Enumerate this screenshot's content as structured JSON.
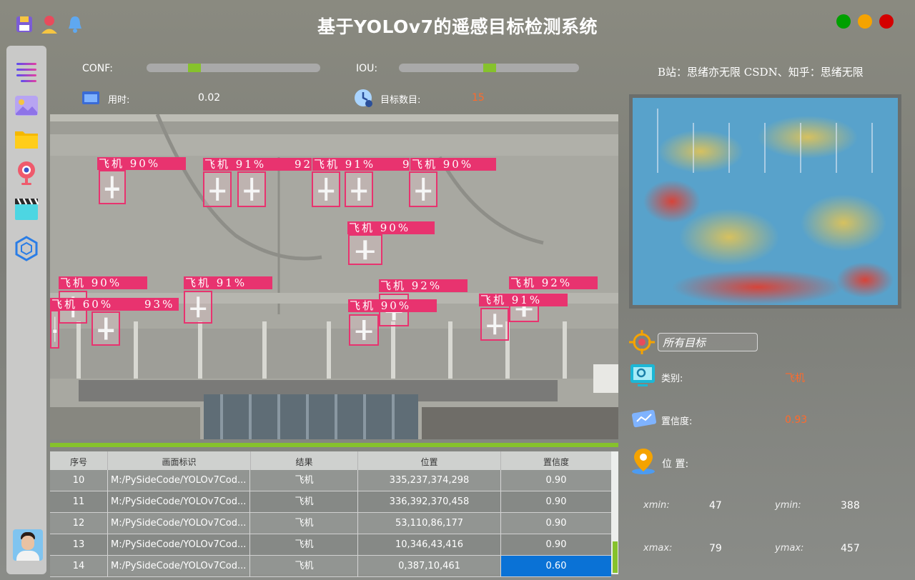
{
  "window": {
    "title": "基于YOLOv7的遥感目标检测系统",
    "title_icons": [
      "save-icon",
      "user-icon",
      "bell-icon"
    ],
    "controls": [
      {
        "name": "close",
        "color": "#00a000"
      },
      {
        "name": "minimize",
        "color": "#f5a300"
      },
      {
        "name": "maximize",
        "color": "#d40000"
      }
    ]
  },
  "sidebar": {
    "items": [
      "menu-icon",
      "image-icon",
      "folder-icon",
      "camera-icon",
      "video-icon",
      "hexagon-icon"
    ],
    "avatar": "avatar"
  },
  "controls": {
    "conf_label": "CONF:",
    "conf_value": 0.3,
    "iou_label": "IOU:",
    "iou_value": 0.5,
    "time_label": "用时:",
    "time_value": "0.02",
    "count_label": "目标数目:",
    "count_value": "15"
  },
  "detection": {
    "boxes": [
      {
        "label": "飞机 90%"
      },
      {
        "label": "飞机 91%"
      },
      {
        "label": "92"
      },
      {
        "label": "飞机 91%"
      },
      {
        "label": "9"
      },
      {
        "label": "飞机 90%"
      },
      {
        "label": "飞机 90%"
      },
      {
        "label": "飞机 90%"
      },
      {
        "label": "飞机 91%"
      },
      {
        "label": "飞机 92%"
      },
      {
        "label": "飞机 92%"
      },
      {
        "label": "飞机 60%"
      },
      {
        "label": "93%"
      },
      {
        "label": "飞机 90%"
      },
      {
        "label": "飞机 91%"
      }
    ]
  },
  "table": {
    "headers": [
      "序号",
      "画面标识",
      "结果",
      "位置",
      "置信度"
    ],
    "rows": [
      {
        "id": "10",
        "source": "M:/PySideCode/YOLOv7Cod...",
        "result": "飞机",
        "pos": "335,237,374,298",
        "conf": "0.90"
      },
      {
        "id": "11",
        "source": "M:/PySideCode/YOLOv7Cod...",
        "result": "飞机",
        "pos": "336,392,370,458",
        "conf": "0.90"
      },
      {
        "id": "12",
        "source": "M:/PySideCode/YOLOv7Cod...",
        "result": "飞机",
        "pos": "53,110,86,177",
        "conf": "0.90"
      },
      {
        "id": "13",
        "source": "M:/PySideCode/YOLOv7Cod...",
        "result": "飞机",
        "pos": "10,346,43,416",
        "conf": "0.90"
      },
      {
        "id": "14",
        "source": "M:/PySideCode/YOLOv7Cod...",
        "result": "飞机",
        "pos": "0,387,10,461",
        "conf": "0.60"
      }
    ],
    "selected_row": 4
  },
  "right": {
    "credit": "B站：思绪亦无限  CSDN、知乎：思绪无限",
    "filter_value": "所有目标",
    "class_label": "类别:",
    "class_value": "飞机",
    "conf_label": "置信度:",
    "conf_value": "0.93",
    "pos_label": "位 置:",
    "xmin_label": "xmin:",
    "xmin_value": "47",
    "ymin_label": "ymin:",
    "ymin_value": "388",
    "xmax_label": "xmax:",
    "xmax_value": "79",
    "ymax_label": "ymax:",
    "ymax_value": "457"
  },
  "colors": {
    "accent_green": "#86c22c",
    "box_pink": "#e8336f",
    "highlight_blue": "#0a72d6",
    "value_orange": "#ff6a2b"
  }
}
